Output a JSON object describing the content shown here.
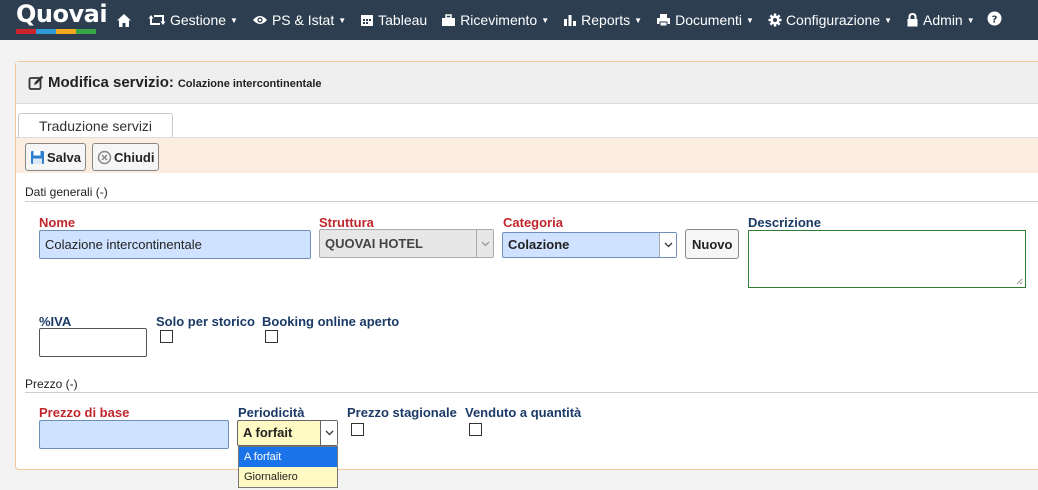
{
  "app": {
    "brand": "Quovai",
    "brand_colors": [
      "#cc2229",
      "#2e9bd6",
      "#f2a81d",
      "#37a649"
    ]
  },
  "navbar": {
    "items": [
      {
        "label": "",
        "icon": "home-icon"
      },
      {
        "label": "Gestione",
        "icon": "retweet-icon",
        "dropdown": true
      },
      {
        "label": "PS & Istat",
        "icon": "eye-icon",
        "dropdown": true
      },
      {
        "label": "Tableau",
        "icon": "calendar-icon",
        "dropdown": false
      },
      {
        "label": "Ricevimento",
        "icon": "briefcase-icon",
        "dropdown": true
      },
      {
        "label": "Reports",
        "icon": "bar-chart-icon",
        "dropdown": true
      },
      {
        "label": "Documenti",
        "icon": "print-icon",
        "dropdown": true
      },
      {
        "label": "Configurazione",
        "icon": "gear-icon",
        "dropdown": true
      },
      {
        "label": "Admin",
        "icon": "lock-icon",
        "dropdown": true
      },
      {
        "label": "",
        "icon": "help-icon"
      }
    ]
  },
  "panel": {
    "title": "Modifica servizio:",
    "subtitle": "Colazione intercontinentale",
    "tab": "Traduzione servizi"
  },
  "toolbar": {
    "save_label": "Salva",
    "close_label": "Chiudi"
  },
  "sections": {
    "general": "Dati generali (-)",
    "price": "Prezzo (-)"
  },
  "fields": {
    "nome": {
      "label": "Nome",
      "value": "Colazione intercontinentale"
    },
    "struttura": {
      "label": "Struttura",
      "value": "QUOVAI HOTEL"
    },
    "categoria": {
      "label": "Categoria",
      "value": "Colazione"
    },
    "nuovo_label": "Nuovo",
    "descrizione": {
      "label": "Descrizione",
      "value": ""
    },
    "iva": {
      "label": "%IVA",
      "value": ""
    },
    "solo_storico": {
      "label": "Solo per storico",
      "checked": false
    },
    "booking": {
      "label": "Booking online aperto",
      "checked": false
    },
    "prezzo_base": {
      "label": "Prezzo di base",
      "value": ""
    },
    "periodicita": {
      "label": "Periodicità",
      "value": "A forfait",
      "options": [
        "A forfait",
        "Giornaliero"
      ],
      "selected_index": 0
    },
    "prezzo_stagionale": {
      "label": "Prezzo stagionale",
      "checked": false
    },
    "venduto_quantita": {
      "label": "Venduto a quantità",
      "checked": false
    }
  }
}
